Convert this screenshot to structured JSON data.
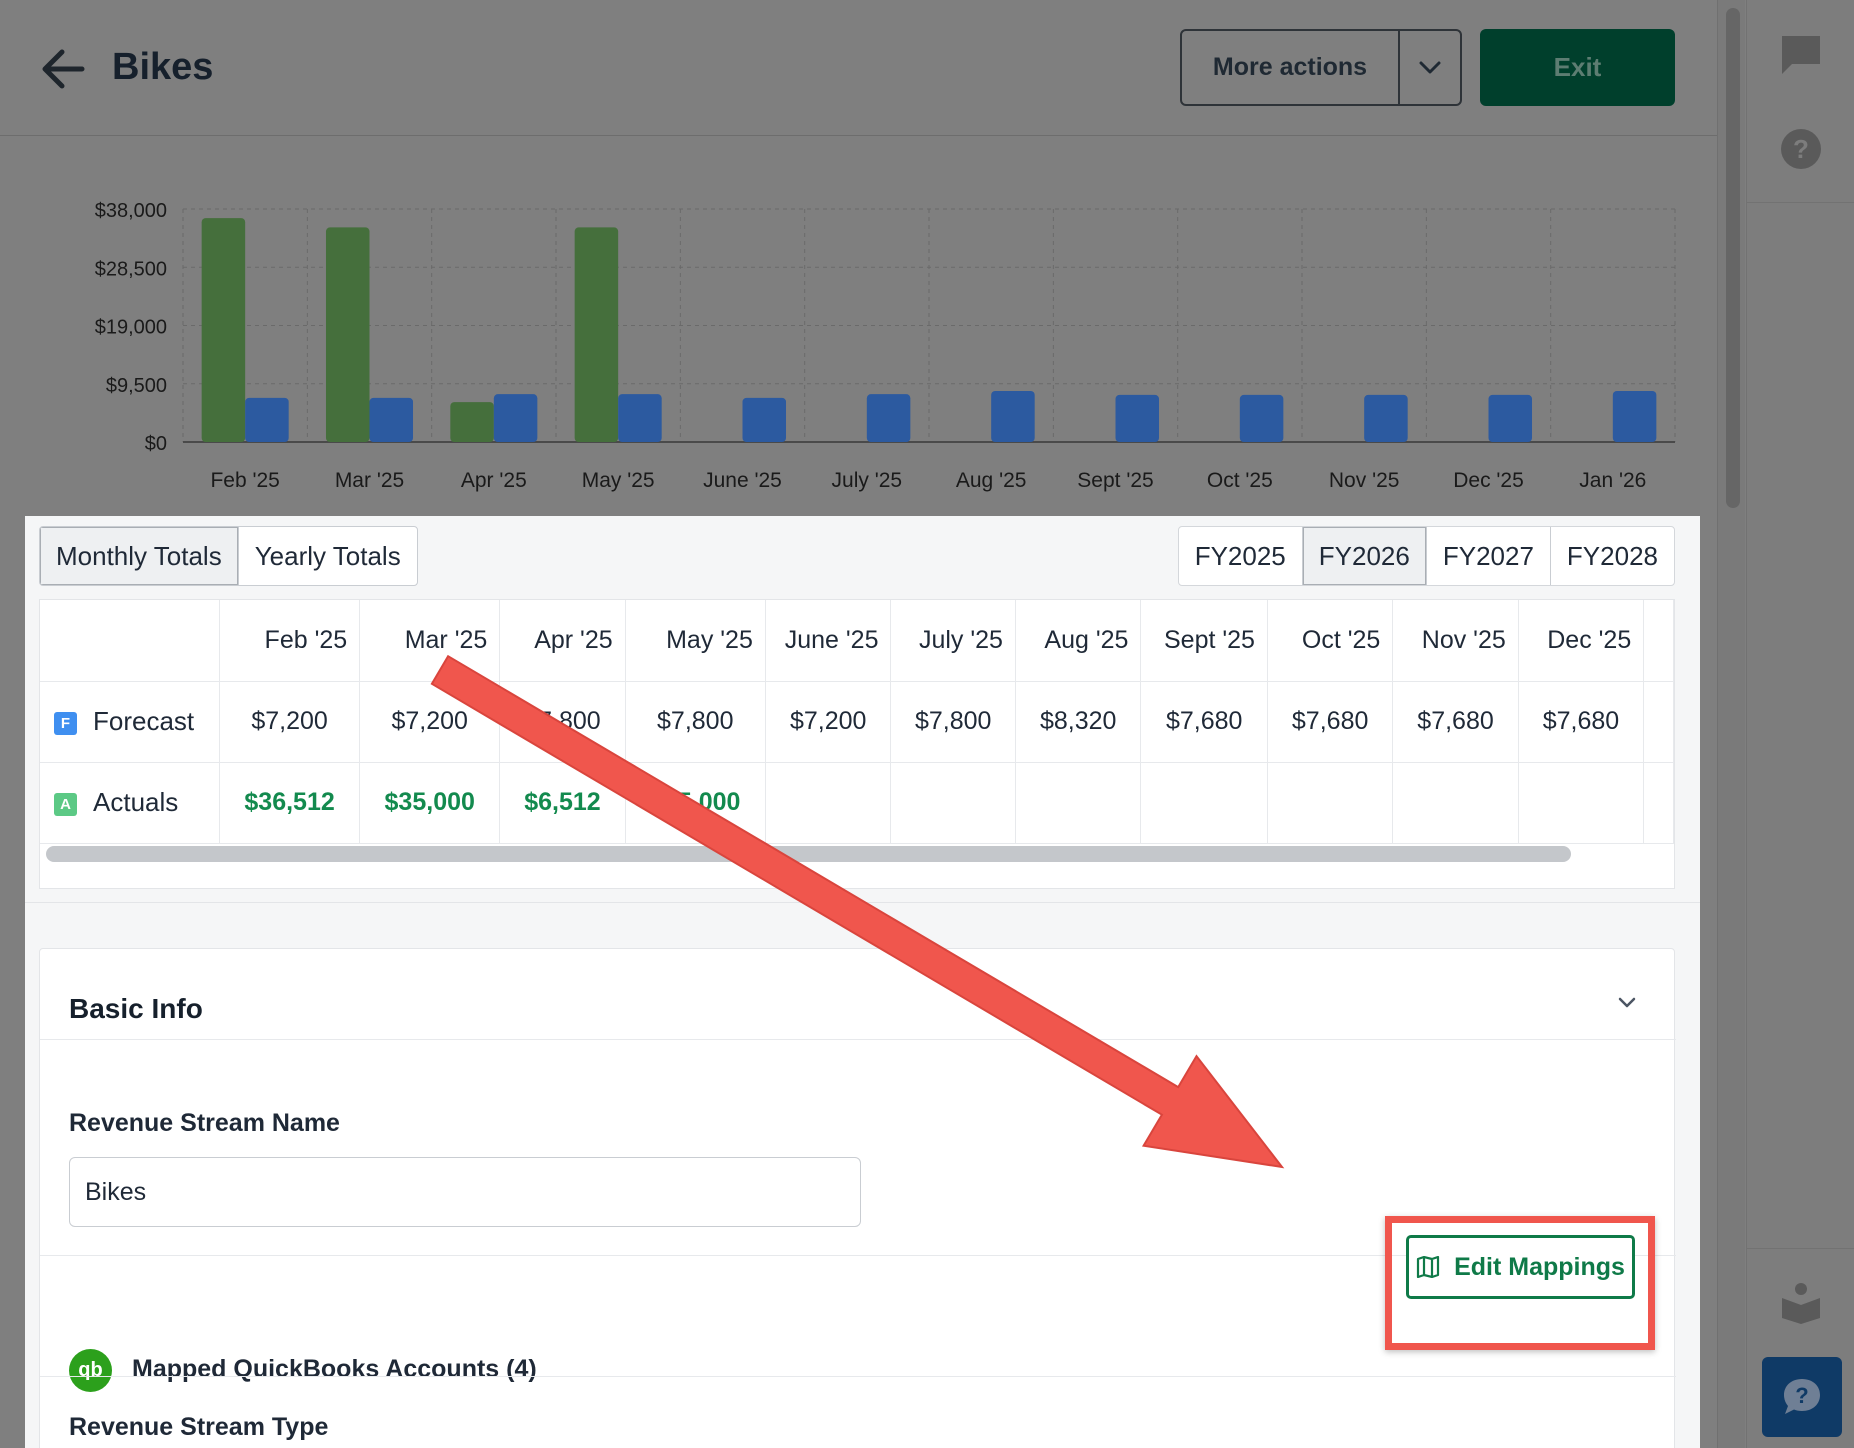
{
  "header": {
    "title": "Bikes",
    "more_actions_label": "More actions",
    "exit_label": "Exit"
  },
  "chart_data": {
    "type": "bar",
    "categories": [
      "Feb '25",
      "Mar '25",
      "Apr '25",
      "May '25",
      "June '25",
      "July '25",
      "Aug '25",
      "Sept '25",
      "Oct '25",
      "Nov '25",
      "Dec '25",
      "Jan '26"
    ],
    "series": [
      {
        "color": "#456f3c",
        "values": [
          36512,
          35000,
          6512,
          35000,
          null,
          null,
          null,
          null,
          null,
          null,
          null,
          null
        ]
      },
      {
        "color": "#2c5aa0",
        "values": [
          7200,
          7200,
          7800,
          7800,
          7200,
          7800,
          8320,
          7680,
          7680,
          7680,
          7680,
          8320
        ]
      }
    ],
    "ylim": [
      0,
      38000
    ],
    "yticks": [
      0,
      9500,
      19000,
      28500,
      38000
    ],
    "ytick_labels": [
      "$0",
      "$9,500",
      "$19,000",
      "$28,500",
      "$38,000"
    ],
    "grid": true
  },
  "totals_toggle": [
    "Monthly Totals",
    "Yearly Totals"
  ],
  "fiscal_years": [
    "FY2025",
    "FY2026",
    "FY2027",
    "FY2028"
  ],
  "table": {
    "months": [
      "Feb '25",
      "Mar '25",
      "Apr '25",
      "May '25",
      "June '25",
      "July '25",
      "Aug '25",
      "Sept '25",
      "Oct '25",
      "Nov '25",
      "Dec '25"
    ],
    "forecast": {
      "badge": "F",
      "label": "Forecast",
      "values": [
        "$7,200",
        "$7,200",
        "$7,800",
        "$7,800",
        "$7,200",
        "$7,800",
        "$8,320",
        "$7,680",
        "$7,680",
        "$7,680",
        "$7,680"
      ]
    },
    "actuals": {
      "badge": "A",
      "label": "Actuals",
      "values": [
        "$36,512",
        "$35,000",
        "$6,512",
        "$35,000",
        "",
        "",
        "",
        "",
        "",
        "",
        ""
      ]
    }
  },
  "basic_info": {
    "title": "Basic Info",
    "revenue_stream_name_label": "Revenue Stream Name",
    "revenue_stream_name_value": "Bikes",
    "qb_logo_text": "qb",
    "mapped_accounts_label": "Mapped QuickBooks Accounts (4)",
    "edit_mappings_label": "Edit Mappings",
    "revenue_stream_type_label": "Revenue Stream Type"
  },
  "icons": {
    "back": "arrow-left-icon",
    "caret": "chevron-down-icon",
    "comment": "comment-icon",
    "help": "help-circle-icon",
    "guide": "reading-person-icon",
    "chat": "chat-question-icon",
    "map": "map-icon"
  },
  "annotation": {
    "color": "#f0564d"
  }
}
